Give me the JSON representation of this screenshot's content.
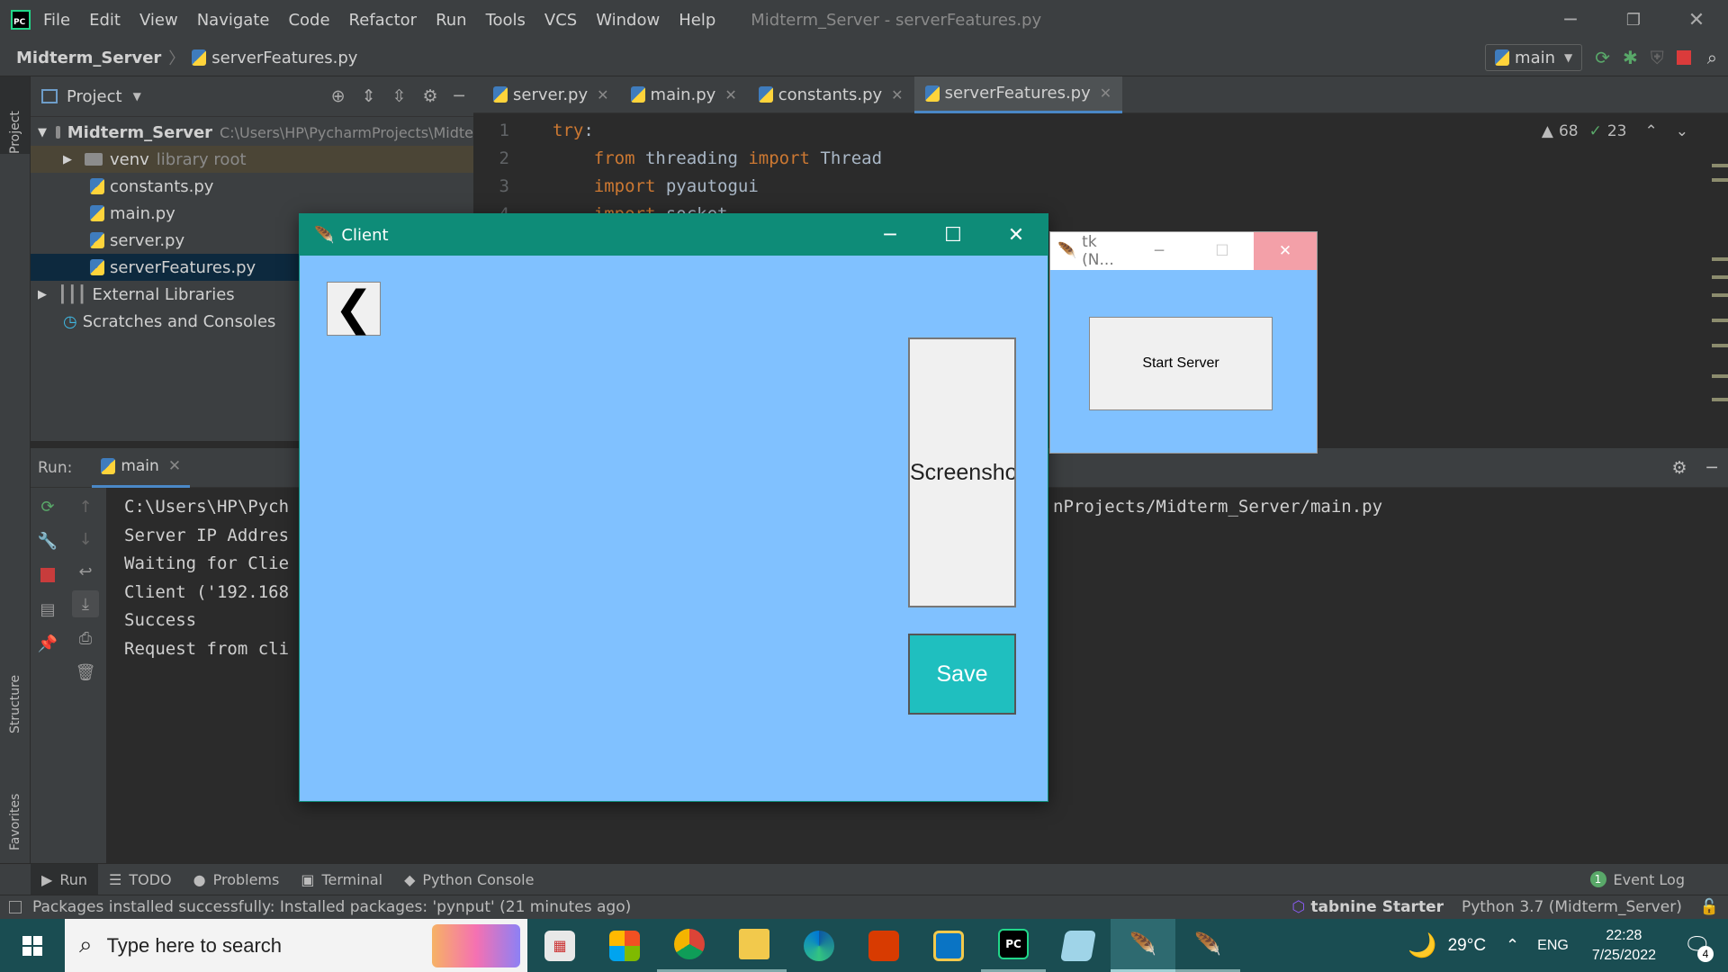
{
  "ide": {
    "menu": [
      "File",
      "Edit",
      "View",
      "Navigate",
      "Code",
      "Refactor",
      "Run",
      "Tools",
      "VCS",
      "Window",
      "Help"
    ],
    "window_title": "Midterm_Server - serverFeatures.py",
    "breadcrumb": {
      "project": "Midterm_Server",
      "file": "serverFeatures.py"
    },
    "run_config": "main",
    "project_panel": {
      "title": "Project",
      "root": "Midterm_Server",
      "root_path": "C:\\Users\\HP\\PycharmProjects\\Midte",
      "venv": "venv",
      "venv_note": "library root",
      "files": [
        "constants.py",
        "main.py",
        "server.py",
        "serverFeatures.py"
      ],
      "external": "External Libraries",
      "scratches": "Scratches and Consoles"
    },
    "tabs": [
      "server.py",
      "main.py",
      "constants.py",
      "serverFeatures.py"
    ],
    "active_tab": "serverFeatures.py",
    "editor": {
      "lines": [
        {
          "num": "1",
          "code": [
            {
              "t": "try",
              "c": "#cc7832"
            },
            {
              "t": ":",
              "c": "#a9b7c6"
            }
          ]
        },
        {
          "num": "2",
          "code": [
            {
              "t": "    from ",
              "c": "#cc7832"
            },
            {
              "t": "threading ",
              "c": "#a9b7c6"
            },
            {
              "t": "import ",
              "c": "#cc7832"
            },
            {
              "t": "Thread",
              "c": "#a9b7c6"
            }
          ]
        },
        {
          "num": "3",
          "code": [
            {
              "t": "    import ",
              "c": "#cc7832"
            },
            {
              "t": "pyautogui",
              "c": "#a9b7c6"
            }
          ]
        },
        {
          "num": "4",
          "code": [
            {
              "t": "    import ",
              "c": "#cc7832"
            },
            {
              "t": "socket",
              "c": "#a9b7c6"
            }
          ]
        }
      ],
      "warnings": "68",
      "weak_warnings": "23"
    },
    "run": {
      "label": "Run:",
      "config": "main",
      "console_lines": [
        "C:\\Users\\HP\\Pych",
        "Server IP Addres",
        "Waiting for Clie",
        "Client ('192.168",
        "Success",
        "Request from cli"
      ],
      "console_right": "nProjects/Midterm_Server/main.py"
    },
    "bottom_tabs": [
      "Run",
      "TODO",
      "Problems",
      "Terminal",
      "Python Console"
    ],
    "event_log": "Event Log",
    "event_count": "1",
    "status_message": "Packages installed successfully: Installed packages: 'pynput' (21 minutes ago)",
    "tabnine": "tabnine",
    "tabnine_plan": "Starter",
    "interpreter": "Python 3.7 (Midterm_Server)",
    "side_labels": {
      "project": "Project",
      "structure": "Structure",
      "favorites": "Favorites"
    }
  },
  "client_window": {
    "title": "Client",
    "back_glyph": "❮",
    "screenshot_label": "Screensho",
    "save_label": "Save"
  },
  "tk_window": {
    "title": "tk (N...",
    "start_label": "Start Server"
  },
  "taskbar": {
    "search_placeholder": "Type here to search",
    "weather": "29°C",
    "lang": "ENG",
    "time": "22:28",
    "date": "7/25/2022",
    "notif_count": "4"
  },
  "colors": {
    "client_bg": "#80c1ff",
    "client_title": "#0e8c78",
    "save_button": "#1fbfbf",
    "ide_bg": "#2b2b2b",
    "taskbar": "#1a4d52"
  }
}
